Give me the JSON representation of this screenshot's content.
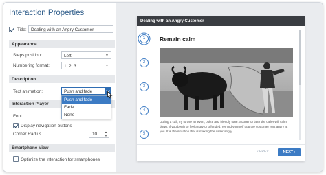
{
  "window": {
    "title": "Interaction Properties"
  },
  "properties": {
    "title_label": "Title:",
    "title_value": "Dealing with an Angry Customer",
    "appearance": {
      "header": "Appearance",
      "steps_position_label": "Steps position:",
      "steps_position_value": "Left",
      "numbering_format_label": "Numbering format:",
      "numbering_format_value": "1, 2, 3"
    },
    "description": {
      "header": "Description",
      "text_animation_label": "Text animation:",
      "text_animation_value": "Push and fade",
      "options": [
        "Push and fade",
        "Fade",
        "None"
      ]
    },
    "interaction_player": {
      "header": "Interaction Player",
      "font_label": "Font",
      "display_nav_label": "Display navigation buttons",
      "display_nav_checked": true,
      "corner_radius_label": "Corner Radius",
      "corner_radius_value": "10"
    },
    "smartphone": {
      "header": "Smartphone View",
      "optimize_label": "Optimize the interaction for smartphones",
      "optimize_checked": false
    }
  },
  "preview": {
    "header": "Dealing with an Angry Customer",
    "steps": [
      "1",
      "2",
      "3",
      "4",
      "5"
    ],
    "current_step": 1,
    "content_title": "Remain calm",
    "content_text": "During a call, try to use an even, polite and friendly tone. Sooner or later the caller will calm down. If you begin to feel angry or offended, remind yourself that the customer isn't angry at you. It is the situation that is making the caller angry.",
    "prev_label": "‹ PREV",
    "next_label": "NEXT ›"
  },
  "colors": {
    "accent": "#3c7bc4",
    "title_blue": "#2f5d8a",
    "player_header": "#3a3d42"
  }
}
